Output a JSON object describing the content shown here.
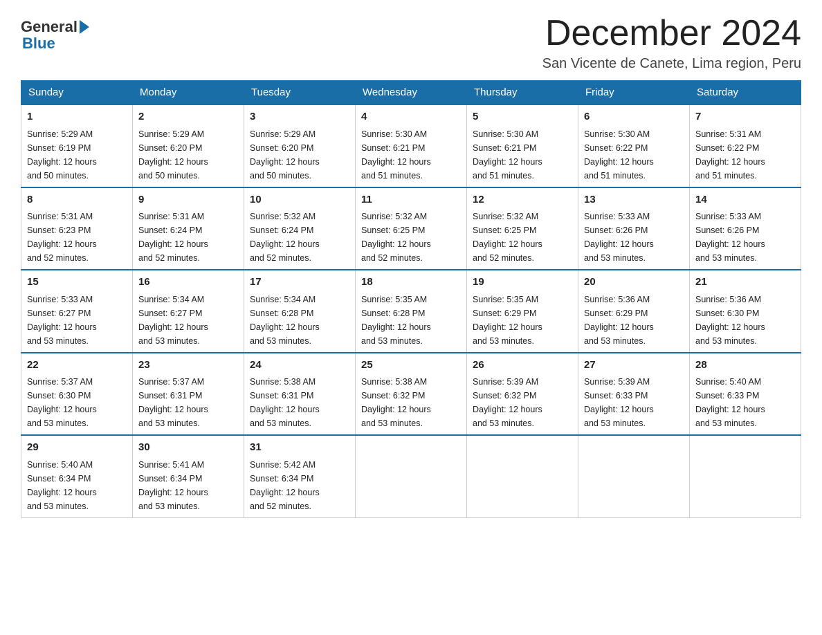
{
  "logo": {
    "general": "General",
    "blue": "Blue"
  },
  "title": "December 2024",
  "subtitle": "San Vicente de Canete, Lima region, Peru",
  "weekdays": [
    "Sunday",
    "Monday",
    "Tuesday",
    "Wednesday",
    "Thursday",
    "Friday",
    "Saturday"
  ],
  "weeks": [
    [
      {
        "day": "1",
        "sunrise": "5:29 AM",
        "sunset": "6:19 PM",
        "daylight": "12 hours and 50 minutes."
      },
      {
        "day": "2",
        "sunrise": "5:29 AM",
        "sunset": "6:20 PM",
        "daylight": "12 hours and 50 minutes."
      },
      {
        "day": "3",
        "sunrise": "5:29 AM",
        "sunset": "6:20 PM",
        "daylight": "12 hours and 50 minutes."
      },
      {
        "day": "4",
        "sunrise": "5:30 AM",
        "sunset": "6:21 PM",
        "daylight": "12 hours and 51 minutes."
      },
      {
        "day": "5",
        "sunrise": "5:30 AM",
        "sunset": "6:21 PM",
        "daylight": "12 hours and 51 minutes."
      },
      {
        "day": "6",
        "sunrise": "5:30 AM",
        "sunset": "6:22 PM",
        "daylight": "12 hours and 51 minutes."
      },
      {
        "day": "7",
        "sunrise": "5:31 AM",
        "sunset": "6:22 PM",
        "daylight": "12 hours and 51 minutes."
      }
    ],
    [
      {
        "day": "8",
        "sunrise": "5:31 AM",
        "sunset": "6:23 PM",
        "daylight": "12 hours and 52 minutes."
      },
      {
        "day": "9",
        "sunrise": "5:31 AM",
        "sunset": "6:24 PM",
        "daylight": "12 hours and 52 minutes."
      },
      {
        "day": "10",
        "sunrise": "5:32 AM",
        "sunset": "6:24 PM",
        "daylight": "12 hours and 52 minutes."
      },
      {
        "day": "11",
        "sunrise": "5:32 AM",
        "sunset": "6:25 PM",
        "daylight": "12 hours and 52 minutes."
      },
      {
        "day": "12",
        "sunrise": "5:32 AM",
        "sunset": "6:25 PM",
        "daylight": "12 hours and 52 minutes."
      },
      {
        "day": "13",
        "sunrise": "5:33 AM",
        "sunset": "6:26 PM",
        "daylight": "12 hours and 53 minutes."
      },
      {
        "day": "14",
        "sunrise": "5:33 AM",
        "sunset": "6:26 PM",
        "daylight": "12 hours and 53 minutes."
      }
    ],
    [
      {
        "day": "15",
        "sunrise": "5:33 AM",
        "sunset": "6:27 PM",
        "daylight": "12 hours and 53 minutes."
      },
      {
        "day": "16",
        "sunrise": "5:34 AM",
        "sunset": "6:27 PM",
        "daylight": "12 hours and 53 minutes."
      },
      {
        "day": "17",
        "sunrise": "5:34 AM",
        "sunset": "6:28 PM",
        "daylight": "12 hours and 53 minutes."
      },
      {
        "day": "18",
        "sunrise": "5:35 AM",
        "sunset": "6:28 PM",
        "daylight": "12 hours and 53 minutes."
      },
      {
        "day": "19",
        "sunrise": "5:35 AM",
        "sunset": "6:29 PM",
        "daylight": "12 hours and 53 minutes."
      },
      {
        "day": "20",
        "sunrise": "5:36 AM",
        "sunset": "6:29 PM",
        "daylight": "12 hours and 53 minutes."
      },
      {
        "day": "21",
        "sunrise": "5:36 AM",
        "sunset": "6:30 PM",
        "daylight": "12 hours and 53 minutes."
      }
    ],
    [
      {
        "day": "22",
        "sunrise": "5:37 AM",
        "sunset": "6:30 PM",
        "daylight": "12 hours and 53 minutes."
      },
      {
        "day": "23",
        "sunrise": "5:37 AM",
        "sunset": "6:31 PM",
        "daylight": "12 hours and 53 minutes."
      },
      {
        "day": "24",
        "sunrise": "5:38 AM",
        "sunset": "6:31 PM",
        "daylight": "12 hours and 53 minutes."
      },
      {
        "day": "25",
        "sunrise": "5:38 AM",
        "sunset": "6:32 PM",
        "daylight": "12 hours and 53 minutes."
      },
      {
        "day": "26",
        "sunrise": "5:39 AM",
        "sunset": "6:32 PM",
        "daylight": "12 hours and 53 minutes."
      },
      {
        "day": "27",
        "sunrise": "5:39 AM",
        "sunset": "6:33 PM",
        "daylight": "12 hours and 53 minutes."
      },
      {
        "day": "28",
        "sunrise": "5:40 AM",
        "sunset": "6:33 PM",
        "daylight": "12 hours and 53 minutes."
      }
    ],
    [
      {
        "day": "29",
        "sunrise": "5:40 AM",
        "sunset": "6:34 PM",
        "daylight": "12 hours and 53 minutes."
      },
      {
        "day": "30",
        "sunrise": "5:41 AM",
        "sunset": "6:34 PM",
        "daylight": "12 hours and 53 minutes."
      },
      {
        "day": "31",
        "sunrise": "5:42 AM",
        "sunset": "6:34 PM",
        "daylight": "12 hours and 52 minutes."
      },
      null,
      null,
      null,
      null
    ]
  ],
  "labels": {
    "sunrise": "Sunrise:",
    "sunset": "Sunset:",
    "daylight": "Daylight: 12 hours"
  }
}
